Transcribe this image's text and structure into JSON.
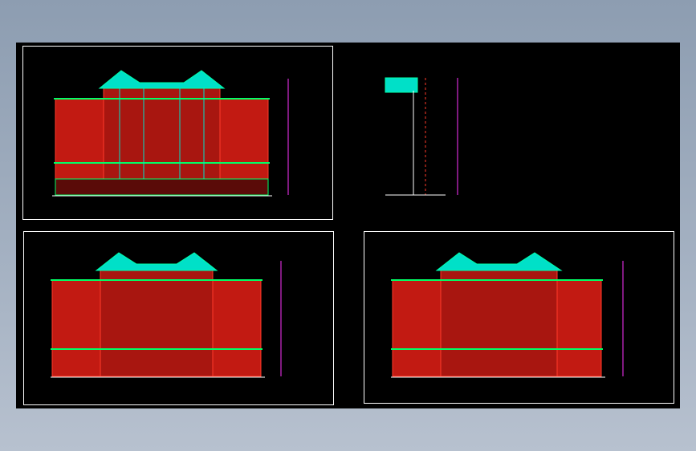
{
  "app": {
    "title": ""
  },
  "colors": {
    "background": "#000000",
    "frame": "#ffffff",
    "wall_fill": "#c21a12",
    "wall_line": "#ff3a2a",
    "trim": "#00ff66",
    "roof": "#00e0c8",
    "dimension": "#ff33ff",
    "column_line": "#e8e8e8"
  },
  "sheets": [
    {
      "name": "elevation-top-left",
      "kind": "elevation"
    },
    {
      "name": "section-top-right",
      "kind": "section"
    },
    {
      "name": "elevation-bottom-left",
      "kind": "elevation"
    },
    {
      "name": "elevation-bottom-right",
      "kind": "elevation"
    }
  ]
}
